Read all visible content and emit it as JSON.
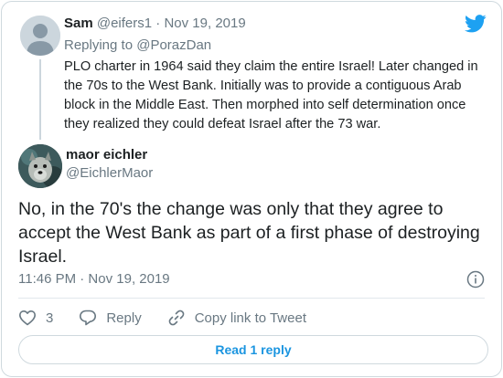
{
  "colors": {
    "brand": "#1da1f2",
    "link": "#1b95e0",
    "muted": "#697882",
    "text": "#1c2022"
  },
  "parent": {
    "name": "Sam",
    "handle": "@eifers1",
    "date": "Nov 19, 2019",
    "replying_label": "Replying to",
    "replying_to": "@PorazDan",
    "text": "PLO charter in 1964 said they claim the entire Israel! Later changed in the 70s to the West Bank. Initially was to provide a contiguous Arab block in the Middle East. Then morphed into self determination once they realized they could defeat Israel after the 73 war."
  },
  "tweet": {
    "name": "maor eichler",
    "handle": "@EichlerMaor",
    "text": "No, in the 70's the change was only that they agree to accept the West Bank as part of a first phase of destroying Israel.",
    "timestamp": "11:46 PM · Nov 19, 2019"
  },
  "actions": {
    "like_count": "3",
    "reply_label": "Reply",
    "copy_link_label": "Copy link to Tweet"
  },
  "read_replies_label": "Read 1 reply",
  "icons": [
    "twitter-bird-icon",
    "info-icon",
    "heart-icon",
    "reply-icon",
    "link-icon"
  ]
}
